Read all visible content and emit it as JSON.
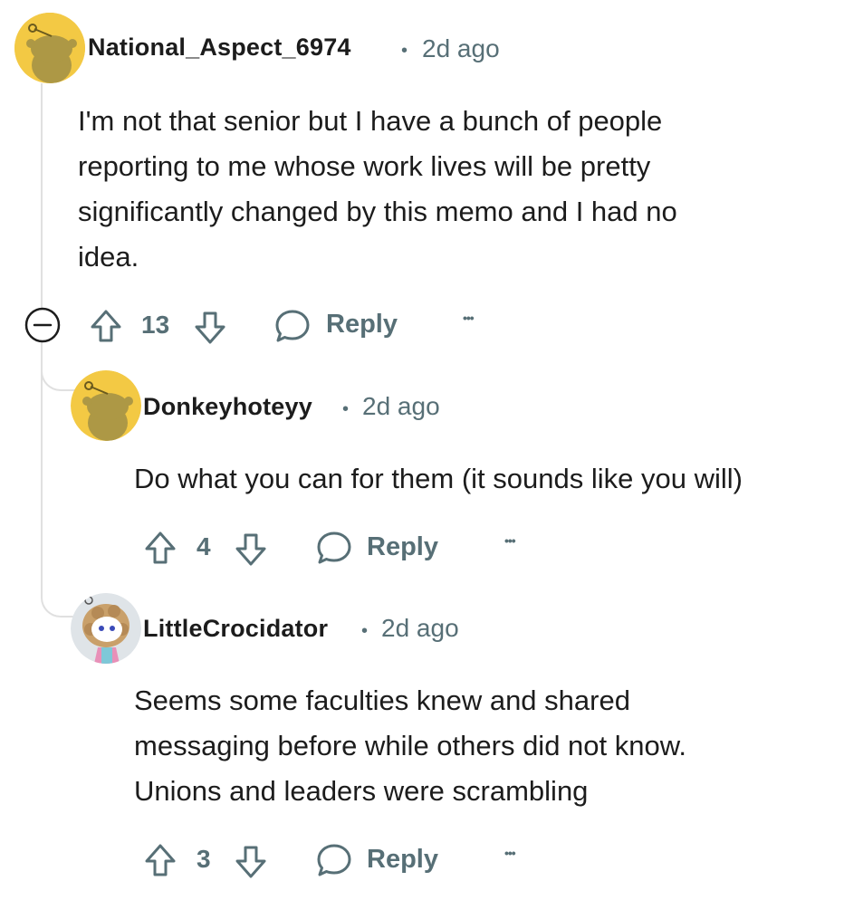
{
  "comments": [
    {
      "username": "National_Aspect_6974",
      "separator": "•",
      "time": "2d ago",
      "body_lines": [
        "I'm not that senior but I have a bunch of people",
        "reporting to me whose work lives will be pretty",
        "significantly changed by this memo and I had no",
        "idea."
      ],
      "votes": "13",
      "reply_label": "Reply",
      "more_label": "•••",
      "avatar_color": "#f3c944"
    },
    {
      "username": "Donkeyhoteyy",
      "separator": "•",
      "time": "2d ago",
      "body_lines": [
        "Do what you can for them (it sounds like you will)"
      ],
      "votes": "4",
      "reply_label": "Reply",
      "more_label": "•••",
      "avatar_color": "#f3c944"
    },
    {
      "username": "LittleCrocidator",
      "separator": "•",
      "time": "2d ago",
      "body_lines": [
        "Seems some faculties knew and shared",
        "messaging before while others did not know.",
        "Unions and leaders were scrambling"
      ],
      "votes": "3",
      "reply_label": "Reply",
      "more_label": "•••",
      "avatar_color": "#dfe4e8"
    }
  ],
  "collapse_icon": "minus-circle-icon",
  "colors": {
    "meta": "#576f76",
    "thread_line": "#e0e0e0",
    "text": "#1c1c1c"
  }
}
